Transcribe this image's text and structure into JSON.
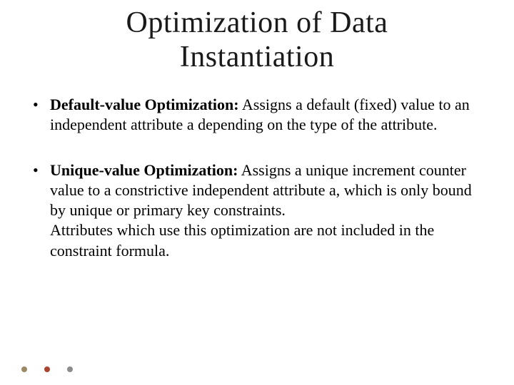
{
  "title_line1": "Optimization of Data",
  "title_line2": "Instantiation",
  "bullets": [
    {
      "term": "Default-value Optimization:",
      "body": " Assigns a default (fixed) value to an independent attribute a depending on the type of the attribute."
    },
    {
      "term": "Unique-value Optimization:",
      "body": " Assigns a unique increment counter value to a constrictive independent attribute a, which is only bound by unique or primary key constraints.",
      "extra": "Attributes which use this optimization are not included in the constraint formula."
    }
  ]
}
